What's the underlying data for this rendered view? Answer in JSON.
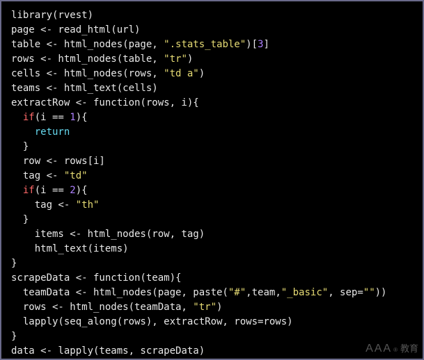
{
  "code": {
    "lines": [
      {
        "indent": 0,
        "tokens": [
          {
            "t": "library(rvest)",
            "c": "plain"
          }
        ]
      },
      {
        "indent": 0,
        "tokens": [
          {
            "t": "page <- read_html(url)",
            "c": "plain"
          }
        ]
      },
      {
        "indent": 0,
        "tokens": [
          {
            "t": "table <- html_nodes(page, ",
            "c": "plain"
          },
          {
            "t": "\".stats_table\"",
            "c": "k-yellow"
          },
          {
            "t": ")[",
            "c": "plain"
          },
          {
            "t": "3",
            "c": "k-purple"
          },
          {
            "t": "]",
            "c": "plain"
          }
        ]
      },
      {
        "indent": 0,
        "tokens": [
          {
            "t": "rows <- html_nodes(table, ",
            "c": "plain"
          },
          {
            "t": "\"tr\"",
            "c": "k-yellow"
          },
          {
            "t": ")",
            "c": "plain"
          }
        ]
      },
      {
        "indent": 0,
        "tokens": [
          {
            "t": "cells <- html_nodes(rows, ",
            "c": "plain"
          },
          {
            "t": "\"td a\"",
            "c": "k-yellow"
          },
          {
            "t": ")",
            "c": "plain"
          }
        ]
      },
      {
        "indent": 0,
        "tokens": [
          {
            "t": "teams <- html_text(cells)",
            "c": "plain"
          }
        ]
      },
      {
        "indent": 0,
        "tokens": [
          {
            "t": "extractRow <- function(rows, i){",
            "c": "plain"
          }
        ]
      },
      {
        "indent": 1,
        "tokens": [
          {
            "t": "if",
            "c": "k-red"
          },
          {
            "t": "(i == ",
            "c": "plain"
          },
          {
            "t": "1",
            "c": "k-purple"
          },
          {
            "t": "){",
            "c": "plain"
          }
        ]
      },
      {
        "indent": 2,
        "tokens": [
          {
            "t": "return",
            "c": "k-cyan"
          }
        ]
      },
      {
        "indent": 1,
        "tokens": [
          {
            "t": "}",
            "c": "plain"
          }
        ]
      },
      {
        "indent": 1,
        "tokens": [
          {
            "t": "row <- rows[i]",
            "c": "plain"
          }
        ]
      },
      {
        "indent": 1,
        "tokens": [
          {
            "t": "tag <- ",
            "c": "plain"
          },
          {
            "t": "\"td\"",
            "c": "k-yellow"
          }
        ]
      },
      {
        "indent": 1,
        "tokens": [
          {
            "t": "if",
            "c": "k-red"
          },
          {
            "t": "(i == ",
            "c": "plain"
          },
          {
            "t": "2",
            "c": "k-purple"
          },
          {
            "t": "){",
            "c": "plain"
          }
        ]
      },
      {
        "indent": 2,
        "tokens": [
          {
            "t": "tag <- ",
            "c": "plain"
          },
          {
            "t": "\"th\"",
            "c": "k-yellow"
          }
        ]
      },
      {
        "indent": 1,
        "tokens": [
          {
            "t": "}",
            "c": "plain"
          }
        ]
      },
      {
        "indent": 2,
        "tokens": [
          {
            "t": "items <- html_nodes(row, tag)",
            "c": "plain"
          }
        ]
      },
      {
        "indent": 2,
        "tokens": [
          {
            "t": "html_text(items)",
            "c": "plain"
          }
        ]
      },
      {
        "indent": 0,
        "tokens": [
          {
            "t": "}",
            "c": "plain"
          }
        ]
      },
      {
        "indent": 0,
        "tokens": [
          {
            "t": "scrapeData <- function(team){",
            "c": "plain"
          }
        ]
      },
      {
        "indent": 1,
        "tokens": [
          {
            "t": "teamData <- html_nodes(page, paste(",
            "c": "plain"
          },
          {
            "t": "\"#\"",
            "c": "k-yellow"
          },
          {
            "t": ",team,",
            "c": "plain"
          },
          {
            "t": "\"_basic\"",
            "c": "k-yellow"
          },
          {
            "t": ", sep=",
            "c": "plain"
          },
          {
            "t": "\"\"",
            "c": "k-yellow"
          },
          {
            "t": "))",
            "c": "plain"
          }
        ]
      },
      {
        "indent": 1,
        "tokens": [
          {
            "t": "rows <- html_nodes(teamData, ",
            "c": "plain"
          },
          {
            "t": "\"tr\"",
            "c": "k-yellow"
          },
          {
            "t": ")",
            "c": "plain"
          }
        ]
      },
      {
        "indent": 1,
        "tokens": [
          {
            "t": "lapply(seq_along(rows), extractRow, rows=rows)",
            "c": "plain"
          }
        ]
      },
      {
        "indent": 0,
        "tokens": [
          {
            "t": "}",
            "c": "plain"
          }
        ]
      },
      {
        "indent": 0,
        "tokens": [
          {
            "t": "data <- lapply(teams, scrapeData)",
            "c": "plain"
          }
        ]
      }
    ]
  },
  "watermark": {
    "latin": "AAA",
    "reg": "®",
    "cjk": "教育"
  },
  "colors": {
    "bg": "#000000",
    "border": "#6a6a8a",
    "text": "#e8e8e8",
    "string": "#e6db74",
    "keyword_if": "#ff6a6a",
    "keyword_return": "#66d9ef",
    "number": "#ae81ff"
  }
}
